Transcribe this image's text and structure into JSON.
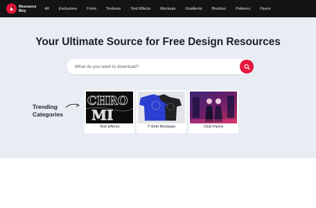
{
  "brand": {
    "line1": "Resource",
    "line2": "Boy"
  },
  "nav": {
    "items": [
      "All",
      "Exclusives",
      "Fonts",
      "Textures",
      "Text Effects",
      "Mockups",
      "Gradients",
      "Brushes",
      "Patterns",
      "Flyers"
    ]
  },
  "hero": {
    "title": "Your Ultimate Source for Free Design Resources",
    "search_placeholder": "What do you want to download?"
  },
  "trending": {
    "line1": "Trending",
    "line2": "Categories",
    "cards": [
      {
        "label": "Text Effects",
        "art_text_top": "CHRO",
        "art_text_bottom": "MI"
      },
      {
        "label": "T-Shirt Mockups"
      },
      {
        "label": "Club Flyers"
      }
    ]
  },
  "colors": {
    "accent": "#e3193d",
    "topbar": "#141417",
    "hero_bg": "#e8edf3"
  }
}
